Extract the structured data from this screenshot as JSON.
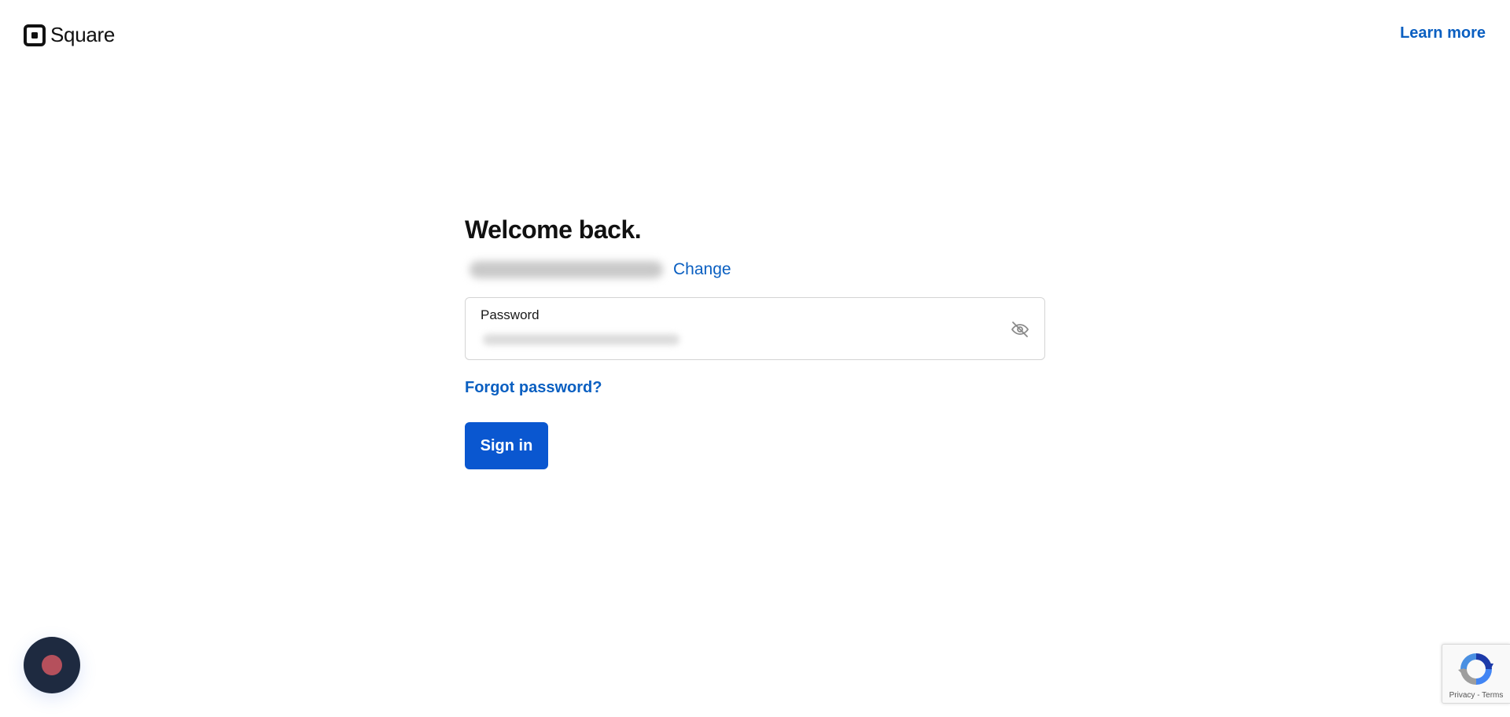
{
  "header": {
    "brand": "Square",
    "learn_more": "Learn more"
  },
  "form": {
    "title": "Welcome back.",
    "change_label": "Change",
    "password_label": "Password",
    "forgot_label": "Forgot password?",
    "signin_label": "Sign in"
  },
  "recaptcha": {
    "privacy": "Privacy",
    "separator": " - ",
    "terms": "Terms"
  },
  "icons": {
    "logo": "square-logo-icon",
    "password_toggle": "eye-slash-icon",
    "widget": "chat-bubble-icon",
    "recaptcha": "recaptcha-icon"
  },
  "colors": {
    "link": "#0a5fc1",
    "primary_button": "#0a57d0",
    "widget_bg": "#1e2a40",
    "widget_dot": "#b5505c"
  }
}
